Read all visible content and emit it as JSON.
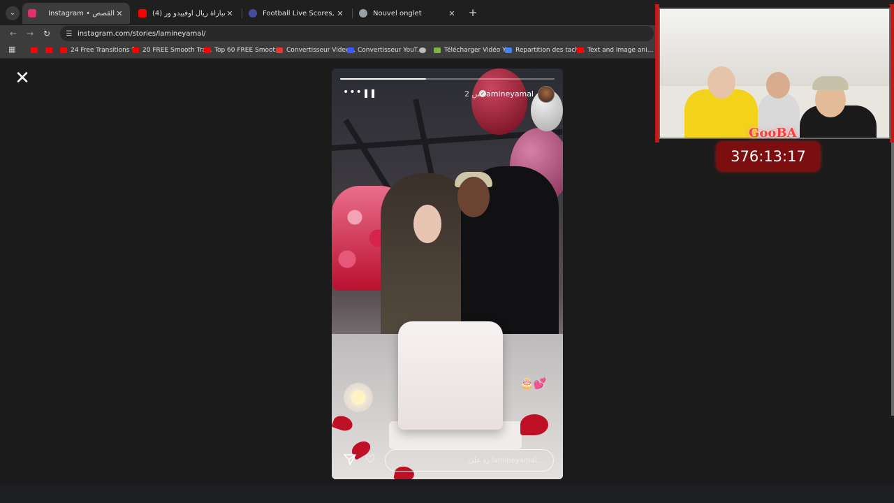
{
  "browser": {
    "tabs": [
      {
        "title": "Instagram • القصص",
        "active": true,
        "favicon_color": "#e1306c"
      },
      {
        "title": "(4) ملخص مباراة ريال أوفييدو ور",
        "active": false,
        "favicon_color": "#ff0000"
      },
      {
        "title": "Football Live Scores, Latest Foo",
        "active": false,
        "favicon_color": "#444c9b"
      },
      {
        "title": "Nouvel onglet",
        "active": false,
        "favicon_color": "#9aa0a6"
      }
    ],
    "new_tab": "+",
    "url": "instagram.com/stories/lamineyamal/",
    "bookmarks": [
      {
        "label": "",
        "color": "#ff0000"
      },
      {
        "label": "",
        "color": "#ff0000"
      },
      {
        "label": "24 Free Transitions f...",
        "color": "#ff0000"
      },
      {
        "label": "20 FREE Smooth Tra...",
        "color": "#ff0000"
      },
      {
        "label": "Top 60 FREE Smoot...",
        "color": "#ff0000"
      },
      {
        "label": "Convertisseur Video...",
        "color": "#e53935"
      },
      {
        "label": "Convertisseur YouT...",
        "color": "#3d5afe"
      },
      {
        "label": "",
        "color": "#bdbdbd"
      },
      {
        "label": "Télécharger Vidéo Y...",
        "color": "#7cb342"
      },
      {
        "label": "Repartition des tach...",
        "color": "#4285f4"
      },
      {
        "label": "Text and Image ani...",
        "color": "#ff0000"
      }
    ]
  },
  "story": {
    "username": "lamineyamal",
    "time_ago": "2 س",
    "progress": 0.4,
    "reply_placeholder": "رد على lamineyamal...",
    "emoji": "🎂💕"
  },
  "overlay": {
    "streamer_name": "GooBA",
    "timer": "376:13:17"
  }
}
